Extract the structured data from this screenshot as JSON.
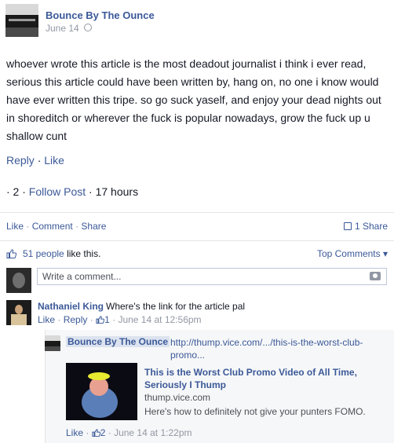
{
  "post": {
    "page_name": "Bounce By The Ounce",
    "date": "June 14",
    "text": "whoever wrote this article is the most deadout journalist i think i ever read, serious this article could have been written by, hang on, no one i know would have ever written this tripe. so go suck yaself, and enjoy your dead nights out in shoreditch or wherever the fuck is popular nowadays, grow the fuck up u shallow cunt",
    "reply_label": "Reply",
    "like_label": "Like",
    "dot": "·",
    "meta_prefix": "· 2 ·",
    "follow_label": "Follow Post",
    "age": "17 hours"
  },
  "actions": {
    "like": "Like",
    "comment": "Comment",
    "share": "Share",
    "share_count": "1 Share"
  },
  "likes": {
    "count_link": "51 people",
    "suffix": "like this.",
    "top_comments": "Top Comments ▾"
  },
  "composer": {
    "placeholder": "Write a comment..."
  },
  "comment1": {
    "author": "Nathaniel King",
    "text": "Where's the link for the article pal",
    "like": "Like",
    "reply": "Reply",
    "likes_count": "1",
    "date": "June 14 at 12:56pm"
  },
  "reply1": {
    "author": "Bounce By The Ounce",
    "url": "http://thump.vice.com/.../this-is-the-worst-club-promo...",
    "card_title": "This is the Worst Club Promo Video of All Time, Seriously I Thump",
    "card_domain": "thump.vice.com",
    "card_desc": "Here's how to definitely not give your punters FOMO.",
    "like": "Like",
    "likes_count": "2",
    "date": "June 14 at 1:22pm"
  },
  "colors": {
    "link": "#3b5998",
    "muted": "#9197a3",
    "text": "#141823"
  }
}
